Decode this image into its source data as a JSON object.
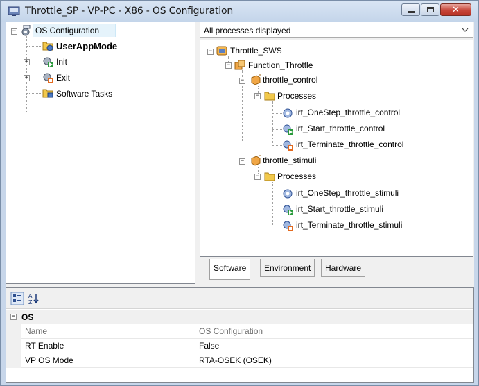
{
  "window": {
    "title": "Throttle_SP - VP-PC - X86 - OS Configuration",
    "close_glyph": "✕"
  },
  "left_tree": {
    "root": "OS Configuration",
    "children": [
      {
        "label": "UserAppMode",
        "bold": true
      },
      {
        "label": "Init"
      },
      {
        "label": "Exit"
      },
      {
        "label": "Software Tasks"
      }
    ]
  },
  "filter": {
    "value": "All processes displayed"
  },
  "right_tree": {
    "root": "Throttle_SWS",
    "function": "Function_Throttle",
    "groups": [
      {
        "label": "throttle_control",
        "folder": "Processes",
        "items": [
          "irt_OneStep_throttle_control",
          "irt_Start_throttle_control",
          "irt_Terminate_throttle_control"
        ]
      },
      {
        "label": "throttle_stimuli",
        "folder": "Processes",
        "items": [
          "irt_OneStep_throttle_stimuli",
          "irt_Start_throttle_stimuli",
          "irt_Terminate_throttle_stimuli"
        ]
      }
    ]
  },
  "tabs": [
    "Software",
    "Environment",
    "Hardware"
  ],
  "property_grid": {
    "category": "OS",
    "rows": [
      {
        "name": "Name",
        "value": "OS Configuration",
        "readonly": true
      },
      {
        "name": "RT Enable",
        "value": "False",
        "readonly": false
      },
      {
        "name": "VP OS Mode",
        "value": "RTA-OSEK (OSEK)",
        "readonly": false
      }
    ]
  },
  "colors": {
    "titlebar": "#c4d5ea",
    "close_button": "#c7463a",
    "selection": "#e5f3fb"
  }
}
